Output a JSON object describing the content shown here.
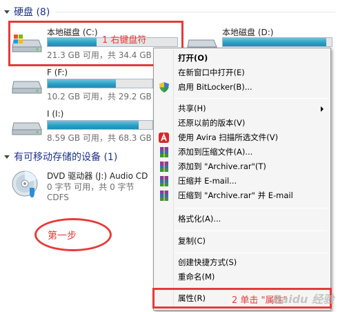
{
  "groups": {
    "hdd": "硬盘 (8)",
    "removable": "有可移动存储的设备 (1)"
  },
  "drives": [
    {
      "name": "本地磁盘 (C:)",
      "info": "21.3 GB 可用，共 34.4 GB",
      "used_fraction": 0.38
    },
    {
      "name": "本地磁盘 (D:)",
      "info": "",
      "used_fraction": 0.95
    },
    {
      "name": "F (F:)",
      "info": "10.2 GB 可用，共 29.2 GB",
      "used_fraction": 0.65
    },
    {
      "name": "I (I:)",
      "info": "8.59 GB 可用，共 68.3 GB",
      "used_fraction": 0.87
    }
  ],
  "dvd": {
    "name": "DVD 驱动器 (J:) Audio CD",
    "info": "0 字节 可用，共 0 字节",
    "fs": "CDFS"
  },
  "annotations": {
    "step1": "1 右键盘符",
    "step2": "2 单击 \"属性\"",
    "oval": "第一步"
  },
  "context_menu": {
    "items": [
      {
        "label": "打开(O)",
        "bold": true,
        "icon": ""
      },
      {
        "label": "在新窗口中打开(E)",
        "icon": ""
      },
      {
        "label": "启用 BitLocker(B)...",
        "icon": "shield-icon"
      },
      {
        "label": "共享(H)",
        "icon": "",
        "submenu": true
      },
      {
        "label": "还原以前的版本(V)",
        "icon": ""
      },
      {
        "label": "使用 Avira 扫描所选文件(V)",
        "icon": "avira-icon"
      },
      {
        "label": "添加到压缩文件(A)...",
        "icon": "winrar-icon"
      },
      {
        "label": "添加到 \"Archive.rar\"(T)",
        "icon": "winrar-icon"
      },
      {
        "label": "压缩并 E-mail...",
        "icon": "winrar-icon"
      },
      {
        "label": "压缩到 \"Archive.rar\" 并 E-mail",
        "icon": "winrar-icon"
      },
      {
        "label": "格式化(A)...",
        "icon": ""
      },
      {
        "label": "复制(C)",
        "icon": ""
      },
      {
        "label": "创建快捷方式(S)",
        "icon": ""
      },
      {
        "label": "重命名(M)",
        "icon": ""
      },
      {
        "label": "属性(R)",
        "icon": ""
      }
    ]
  },
  "watermark": "Baidu 经验",
  "colors": {
    "annotation_red": "#e63a3a",
    "bar_fill": "#2aa0c5",
    "group_title": "#1e3287"
  }
}
